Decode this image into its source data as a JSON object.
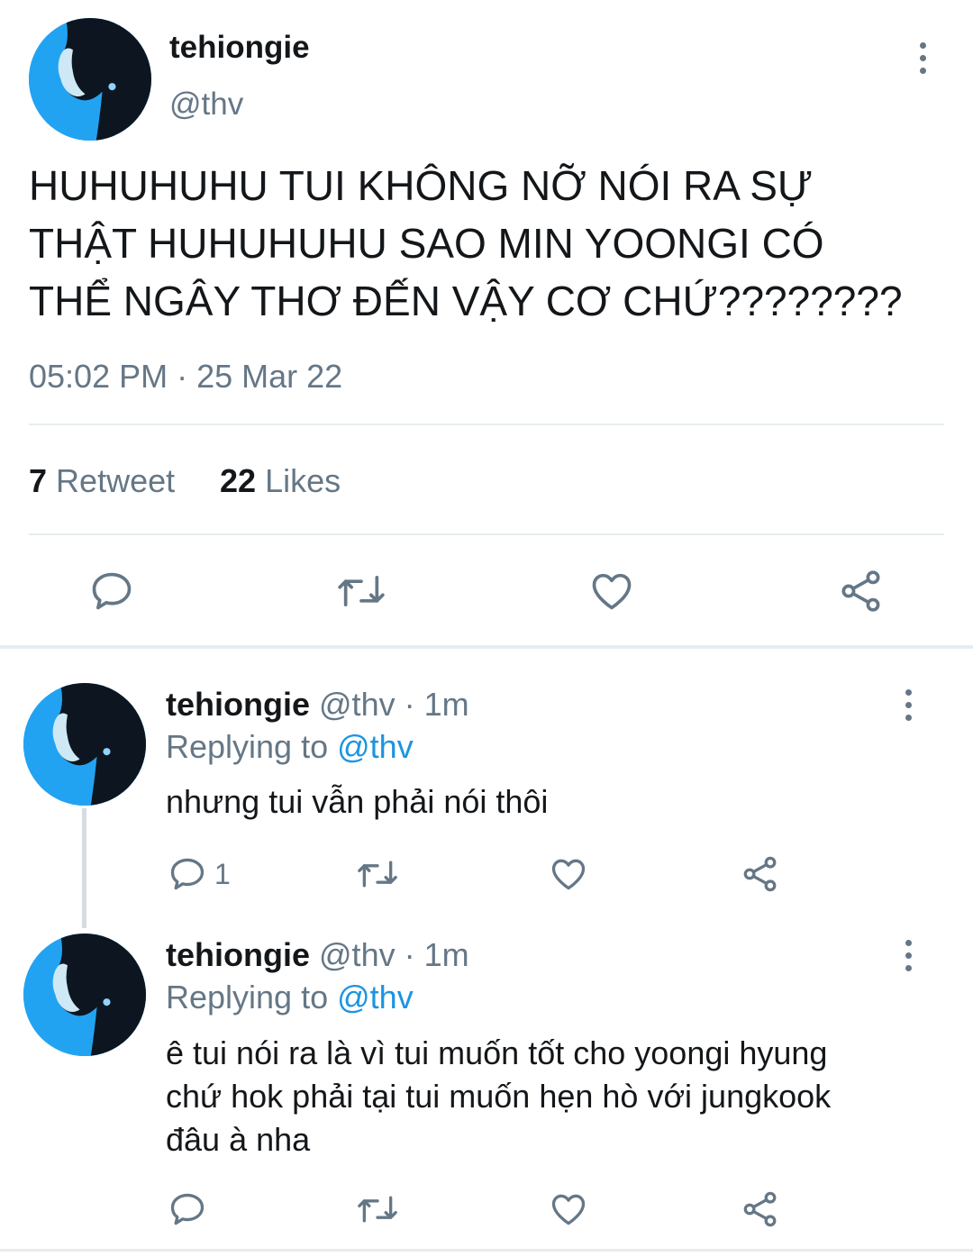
{
  "main_tweet": {
    "display_name": "tehiongie",
    "handle": "@thv",
    "text_lines": [
      "HUHUHUHU TUI KHÔNG NỠ NÓI RA SỰ",
      "THẬT HUHUHUHU SAO MIN YOONGI CÓ",
      "THỂ NGÂY THƠ ĐẾN VẬY CƠ CHỨ????????"
    ],
    "timestamp": "05:02 PM · 25 Mar 22",
    "retweet_count": "7",
    "retweet_label": "Retweet",
    "likes_count": "22",
    "likes_label": "Likes"
  },
  "replies": [
    {
      "display_name": "tehiongie",
      "meta": "@thv · 1m",
      "replying_prefix": "Replying to",
      "replying_handle": "@thv",
      "text_lines": [
        "nhưng tui vẫn phải nói thôi"
      ],
      "reply_count": "1"
    },
    {
      "display_name": "tehiongie",
      "meta": "@thv · 1m",
      "replying_prefix": "Replying to",
      "replying_handle": "@thv",
      "text_lines": [
        "ê tui nói ra là vì tui muốn tốt cho yoongi hyung",
        "chứ hok phải tại tui muốn hẹn hò với jungkook",
        "đâu à nha"
      ],
      "reply_count": ""
    }
  ],
  "icons": {
    "reply": "speech-bubble-icon",
    "retweet": "retweet-arrows-icon",
    "like": "heart-icon",
    "share": "share-nodes-icon",
    "more": "vertical-dots-icon"
  },
  "colors": {
    "text": "#14171a",
    "muted": "#657786",
    "link": "#1b95e0",
    "divider": "#e6ecf0",
    "avatar_bg": "#1f9ff0"
  }
}
